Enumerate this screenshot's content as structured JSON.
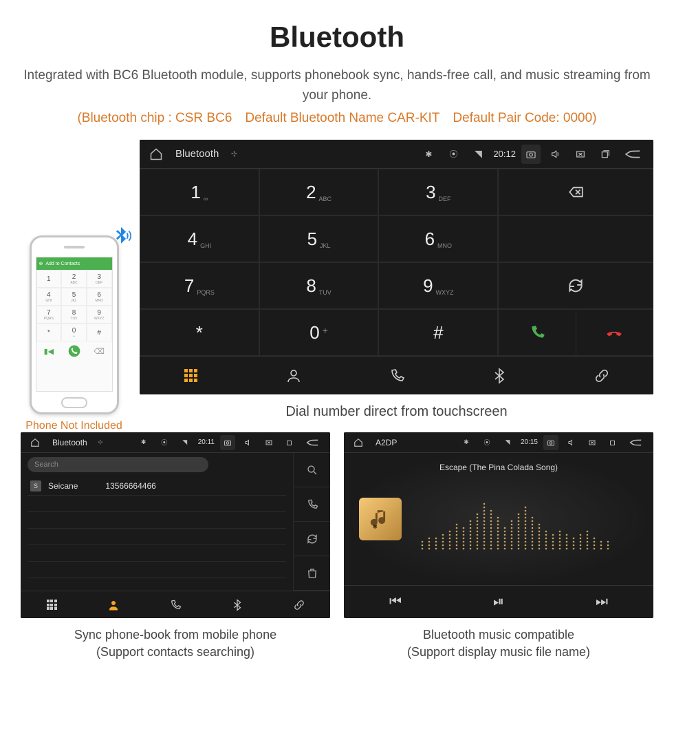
{
  "header": {
    "title": "Bluetooth",
    "description": "Integrated with BC6 Bluetooth module, supports phonebook sync, hands-free call, and music streaming from your phone.",
    "specs": "(Bluetooth chip : CSR BC6 Default Bluetooth Name CAR-KIT Default Pair Code: 0000)"
  },
  "phone_mock": {
    "topbar_label": "Add to Contacts",
    "caption": "Phone Not Included",
    "keys": [
      {
        "d": "1",
        "l": ""
      },
      {
        "d": "2",
        "l": "ABC"
      },
      {
        "d": "3",
        "l": "DEF"
      },
      {
        "d": "4",
        "l": "GHI"
      },
      {
        "d": "5",
        "l": "JKL"
      },
      {
        "d": "6",
        "l": "MNO"
      },
      {
        "d": "7",
        "l": "PQRS"
      },
      {
        "d": "8",
        "l": "TUV"
      },
      {
        "d": "9",
        "l": "WXYZ"
      },
      {
        "d": "*",
        "l": ""
      },
      {
        "d": "0",
        "l": "+"
      },
      {
        "d": "#",
        "l": ""
      }
    ]
  },
  "main_headunit": {
    "statusbar": {
      "title": "Bluetooth",
      "time": "20:12"
    },
    "keypad": [
      {
        "d": "1",
        "l": "∞"
      },
      {
        "d": "2",
        "l": "ABC"
      },
      {
        "d": "3",
        "l": "DEF"
      },
      {
        "d": "4",
        "l": "GHI"
      },
      {
        "d": "5",
        "l": "JKL"
      },
      {
        "d": "6",
        "l": "MNO"
      },
      {
        "d": "7",
        "l": "PQRS"
      },
      {
        "d": "8",
        "l": "TUV"
      },
      {
        "d": "9",
        "l": "WXYZ"
      },
      {
        "d": "*",
        "l": ""
      },
      {
        "d": "0",
        "l": "+",
        "sup": "+"
      },
      {
        "d": "#",
        "l": ""
      }
    ],
    "caption": "Dial number direct from touchscreen"
  },
  "contacts_panel": {
    "statusbar": {
      "title": "Bluetooth",
      "time": "20:11"
    },
    "search_placeholder": "Search",
    "contact": {
      "badge": "S",
      "name": "Seicane",
      "number": "13566664466"
    },
    "caption_line1": "Sync phone-book from mobile phone",
    "caption_line2": "(Support contacts searching)"
  },
  "music_panel": {
    "statusbar": {
      "title": "A2DP",
      "time": "20:15"
    },
    "track_title": "Escape (The Pina Colada Song)",
    "caption_line1": "Bluetooth music compatible",
    "caption_line2": "(Support display music file name)"
  }
}
